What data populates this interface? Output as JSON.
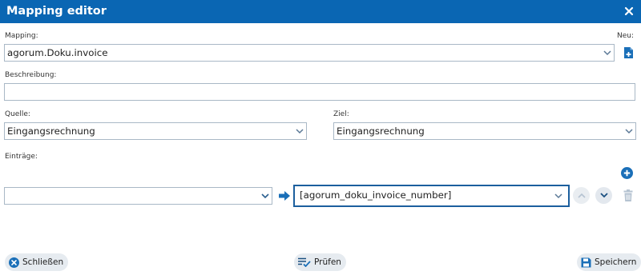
{
  "window": {
    "title": "Mapping editor"
  },
  "mapping": {
    "label": "Mapping:",
    "value": "agorum.Doku.invoice",
    "new_label": "Neu:"
  },
  "description": {
    "label": "Beschreibung:",
    "value": ""
  },
  "source": {
    "label": "Quelle:",
    "value": "Eingangsrechnung"
  },
  "target": {
    "label": "Ziel:",
    "value": "Eingangsrechnung"
  },
  "entries": {
    "label": "Einträge:",
    "rows": [
      {
        "source_value": "",
        "target_value": "[agorum_doku_invoice_number]"
      }
    ]
  },
  "footer": {
    "close_label": "Schließen",
    "check_label": "Prüfen",
    "save_label": "Speichern"
  },
  "colors": {
    "accent": "#0a66b3",
    "icon_blue": "#1a6fb8",
    "border": "#a9b8c6"
  }
}
